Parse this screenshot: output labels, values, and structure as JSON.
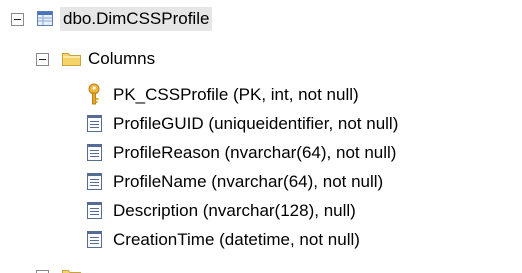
{
  "tree": {
    "table": {
      "label": "dbo.DimCSSProfile",
      "icon": "table-icon",
      "expanded": true
    },
    "columns_folder": {
      "label": "Columns",
      "icon": "folder-icon",
      "expanded": true
    },
    "columns": [
      {
        "label": "PK_CSSProfile (PK, int, not null)",
        "icon": "primary-key-icon"
      },
      {
        "label": "ProfileGUID (uniqueidentifier, not null)",
        "icon": "column-icon"
      },
      {
        "label": "ProfileReason (nvarchar(64), not null)",
        "icon": "column-icon"
      },
      {
        "label": "ProfileName (nvarchar(64), not null)",
        "icon": "column-icon"
      },
      {
        "label": "Description (nvarchar(128), null)",
        "icon": "column-icon"
      },
      {
        "label": "CreationTime (datetime, not null)",
        "icon": "column-icon"
      }
    ]
  },
  "colors": {
    "selection_bg": "#e6e6e6",
    "folder": "#f2c94c",
    "key": "#e5a82a",
    "table_icon": "#3d6fb5"
  }
}
